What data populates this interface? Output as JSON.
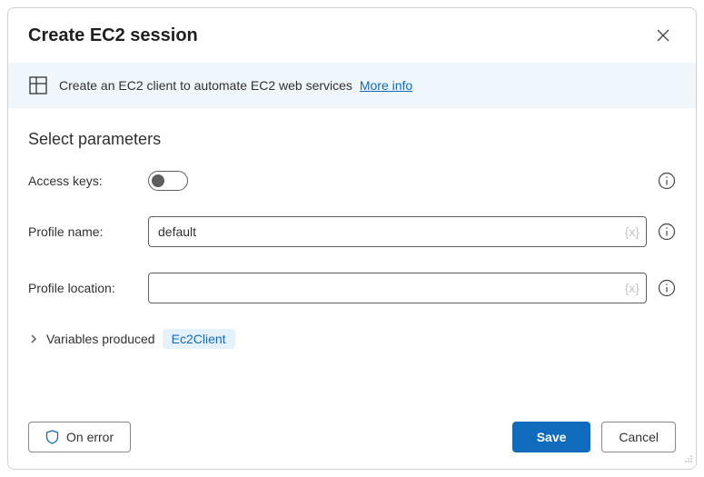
{
  "header": {
    "title": "Create EC2 session"
  },
  "info": {
    "text": "Create an EC2 client to automate EC2 web services",
    "link": "More info"
  },
  "form": {
    "section_title": "Select parameters",
    "access_keys_label": "Access keys:",
    "profile_name_label": "Profile name:",
    "profile_name_value": "default",
    "profile_location_label": "Profile location:",
    "profile_location_value": "",
    "var_token": "{x}"
  },
  "variables": {
    "label": "Variables produced",
    "chip": "Ec2Client"
  },
  "footer": {
    "on_error": "On error",
    "save": "Save",
    "cancel": "Cancel"
  }
}
